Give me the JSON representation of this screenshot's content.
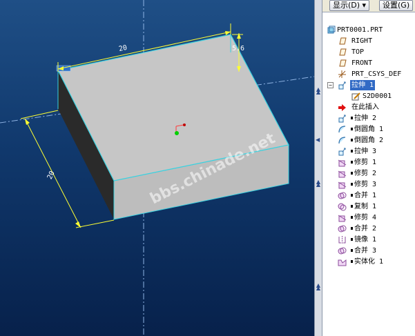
{
  "toolbar": {
    "display_label": "显示(D) ▾",
    "settings_label": "设置(G)"
  },
  "viewport": {
    "dim_top": "20",
    "dim_left": "20",
    "dim_height": "5.6",
    "watermark": "bbs.chinade.net"
  },
  "tree": {
    "items": [
      {
        "label": "PRT0001.PRT",
        "icon": "part-icon"
      },
      {
        "label": "RIGHT",
        "icon": "datum-plane-icon"
      },
      {
        "label": "TOP",
        "icon": "datum-plane-icon"
      },
      {
        "label": "FRONT",
        "icon": "datum-plane-icon"
      },
      {
        "label": "PRT_CSYS_DEF",
        "icon": "csys-icon"
      },
      {
        "label": "拉伸 1",
        "icon": "extrude-icon",
        "selected": true
      },
      {
        "label": "S2D0001",
        "icon": "sketch-icon"
      },
      {
        "label": "在此插入",
        "icon": "insert-here-arrow-icon"
      },
      {
        "label": "拉伸 2",
        "icon": "extrude-icon"
      },
      {
        "label": "倒圆角 1",
        "icon": "round-icon"
      },
      {
        "label": "倒圆角 2",
        "icon": "round-icon"
      },
      {
        "label": "拉伸 3",
        "icon": "extrude-icon"
      },
      {
        "label": "修剪 1",
        "icon": "trim-icon"
      },
      {
        "label": "修剪 2",
        "icon": "trim-icon"
      },
      {
        "label": "修剪 3",
        "icon": "trim-icon"
      },
      {
        "label": "合并 1",
        "icon": "merge-icon"
      },
      {
        "label": "复制 1",
        "icon": "copy-icon"
      },
      {
        "label": "修剪 4",
        "icon": "trim-icon"
      },
      {
        "label": "合并 2",
        "icon": "merge-icon"
      },
      {
        "label": "镜像 1",
        "icon": "mirror-icon"
      },
      {
        "label": "合并 3",
        "icon": "merge-icon"
      },
      {
        "label": "实体化 1",
        "icon": "solidify-icon"
      }
    ]
  },
  "colors": {
    "selection": "#316ac5",
    "edge_highlight": "#39d2e0",
    "dimension": "#ffff33"
  }
}
